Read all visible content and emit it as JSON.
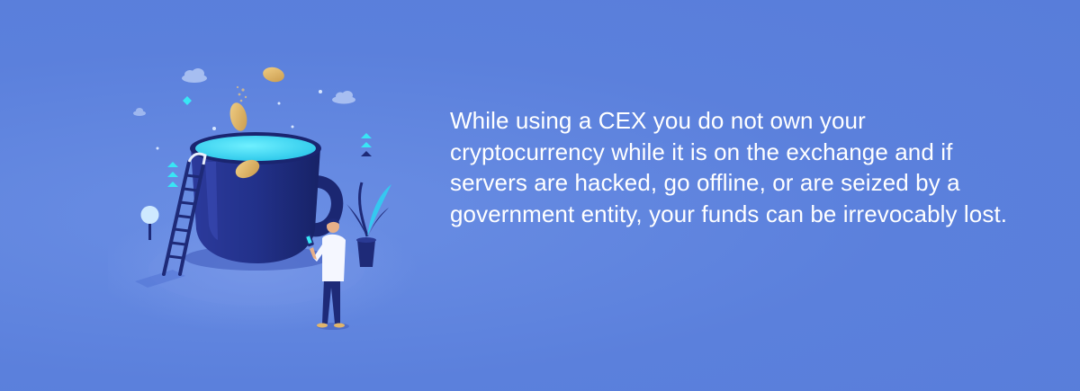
{
  "banner": {
    "message": "While using a CEX you do not own your cryptocurrency while it is on the exchange and if servers are hacked, go offline, or are seized by a government entity, your funds can be irrevocably lost.",
    "illustration": {
      "icon_names": [
        "mug-icon",
        "coin-icon",
        "ladder-icon",
        "person-icon",
        "plant-icon",
        "tree-icon",
        "cloud-icon"
      ]
    },
    "colors": {
      "background": "#5b80dc",
      "mug": "#1e2a78",
      "liquid": "#3fe0f5",
      "coin": "#e1b56b",
      "text": "#ffffff"
    }
  }
}
